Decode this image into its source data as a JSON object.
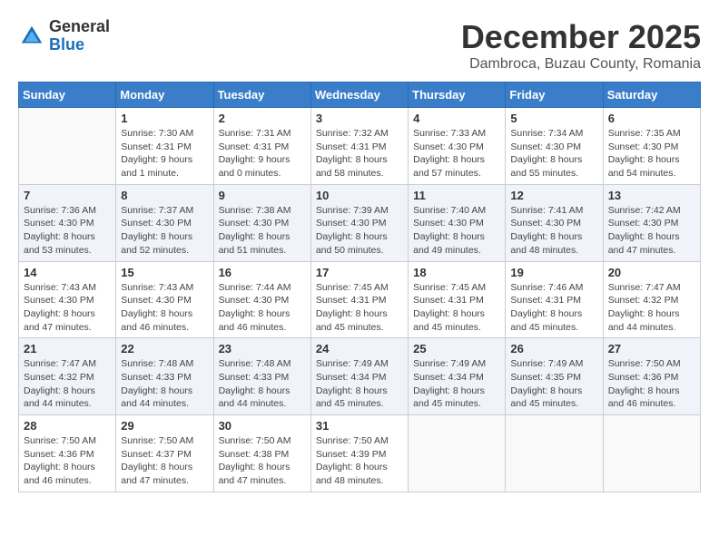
{
  "logo": {
    "general": "General",
    "blue": "Blue"
  },
  "title": "December 2025",
  "subtitle": "Dambroca, Buzau County, Romania",
  "days_header": [
    "Sunday",
    "Monday",
    "Tuesday",
    "Wednesday",
    "Thursday",
    "Friday",
    "Saturday"
  ],
  "weeks": [
    [
      {
        "day": "",
        "info": ""
      },
      {
        "day": "1",
        "info": "Sunrise: 7:30 AM\nSunset: 4:31 PM\nDaylight: 9 hours\nand 1 minute."
      },
      {
        "day": "2",
        "info": "Sunrise: 7:31 AM\nSunset: 4:31 PM\nDaylight: 9 hours\nand 0 minutes."
      },
      {
        "day": "3",
        "info": "Sunrise: 7:32 AM\nSunset: 4:31 PM\nDaylight: 8 hours\nand 58 minutes."
      },
      {
        "day": "4",
        "info": "Sunrise: 7:33 AM\nSunset: 4:30 PM\nDaylight: 8 hours\nand 57 minutes."
      },
      {
        "day": "5",
        "info": "Sunrise: 7:34 AM\nSunset: 4:30 PM\nDaylight: 8 hours\nand 55 minutes."
      },
      {
        "day": "6",
        "info": "Sunrise: 7:35 AM\nSunset: 4:30 PM\nDaylight: 8 hours\nand 54 minutes."
      }
    ],
    [
      {
        "day": "7",
        "info": "Sunrise: 7:36 AM\nSunset: 4:30 PM\nDaylight: 8 hours\nand 53 minutes."
      },
      {
        "day": "8",
        "info": "Sunrise: 7:37 AM\nSunset: 4:30 PM\nDaylight: 8 hours\nand 52 minutes."
      },
      {
        "day": "9",
        "info": "Sunrise: 7:38 AM\nSunset: 4:30 PM\nDaylight: 8 hours\nand 51 minutes."
      },
      {
        "day": "10",
        "info": "Sunrise: 7:39 AM\nSunset: 4:30 PM\nDaylight: 8 hours\nand 50 minutes."
      },
      {
        "day": "11",
        "info": "Sunrise: 7:40 AM\nSunset: 4:30 PM\nDaylight: 8 hours\nand 49 minutes."
      },
      {
        "day": "12",
        "info": "Sunrise: 7:41 AM\nSunset: 4:30 PM\nDaylight: 8 hours\nand 48 minutes."
      },
      {
        "day": "13",
        "info": "Sunrise: 7:42 AM\nSunset: 4:30 PM\nDaylight: 8 hours\nand 47 minutes."
      }
    ],
    [
      {
        "day": "14",
        "info": "Sunrise: 7:43 AM\nSunset: 4:30 PM\nDaylight: 8 hours\nand 47 minutes."
      },
      {
        "day": "15",
        "info": "Sunrise: 7:43 AM\nSunset: 4:30 PM\nDaylight: 8 hours\nand 46 minutes."
      },
      {
        "day": "16",
        "info": "Sunrise: 7:44 AM\nSunset: 4:30 PM\nDaylight: 8 hours\nand 46 minutes."
      },
      {
        "day": "17",
        "info": "Sunrise: 7:45 AM\nSunset: 4:31 PM\nDaylight: 8 hours\nand 45 minutes."
      },
      {
        "day": "18",
        "info": "Sunrise: 7:45 AM\nSunset: 4:31 PM\nDaylight: 8 hours\nand 45 minutes."
      },
      {
        "day": "19",
        "info": "Sunrise: 7:46 AM\nSunset: 4:31 PM\nDaylight: 8 hours\nand 45 minutes."
      },
      {
        "day": "20",
        "info": "Sunrise: 7:47 AM\nSunset: 4:32 PM\nDaylight: 8 hours\nand 44 minutes."
      }
    ],
    [
      {
        "day": "21",
        "info": "Sunrise: 7:47 AM\nSunset: 4:32 PM\nDaylight: 8 hours\nand 44 minutes."
      },
      {
        "day": "22",
        "info": "Sunrise: 7:48 AM\nSunset: 4:33 PM\nDaylight: 8 hours\nand 44 minutes."
      },
      {
        "day": "23",
        "info": "Sunrise: 7:48 AM\nSunset: 4:33 PM\nDaylight: 8 hours\nand 44 minutes."
      },
      {
        "day": "24",
        "info": "Sunrise: 7:49 AM\nSunset: 4:34 PM\nDaylight: 8 hours\nand 45 minutes."
      },
      {
        "day": "25",
        "info": "Sunrise: 7:49 AM\nSunset: 4:34 PM\nDaylight: 8 hours\nand 45 minutes."
      },
      {
        "day": "26",
        "info": "Sunrise: 7:49 AM\nSunset: 4:35 PM\nDaylight: 8 hours\nand 45 minutes."
      },
      {
        "day": "27",
        "info": "Sunrise: 7:50 AM\nSunset: 4:36 PM\nDaylight: 8 hours\nand 46 minutes."
      }
    ],
    [
      {
        "day": "28",
        "info": "Sunrise: 7:50 AM\nSunset: 4:36 PM\nDaylight: 8 hours\nand 46 minutes."
      },
      {
        "day": "29",
        "info": "Sunrise: 7:50 AM\nSunset: 4:37 PM\nDaylight: 8 hours\nand 47 minutes."
      },
      {
        "day": "30",
        "info": "Sunrise: 7:50 AM\nSunset: 4:38 PM\nDaylight: 8 hours\nand 47 minutes."
      },
      {
        "day": "31",
        "info": "Sunrise: 7:50 AM\nSunset: 4:39 PM\nDaylight: 8 hours\nand 48 minutes."
      },
      {
        "day": "",
        "info": ""
      },
      {
        "day": "",
        "info": ""
      },
      {
        "day": "",
        "info": ""
      }
    ]
  ]
}
